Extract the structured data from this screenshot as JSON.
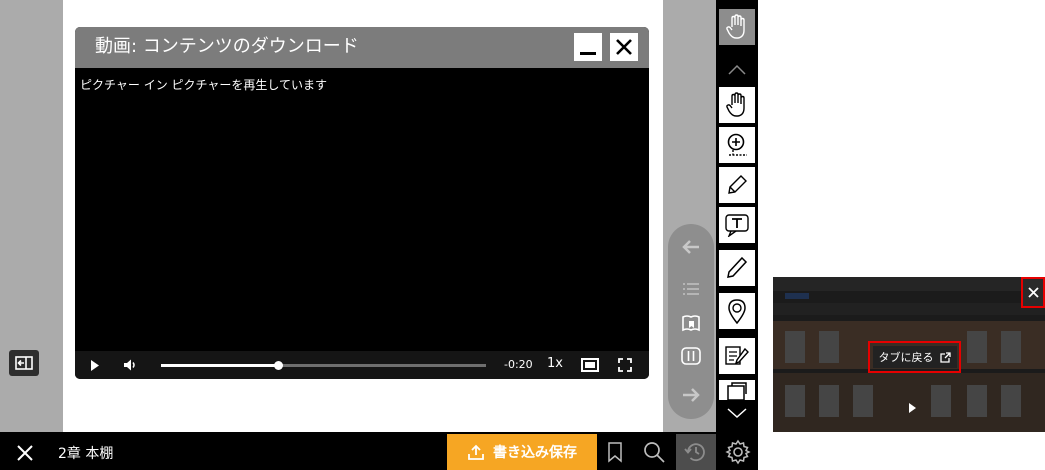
{
  "video_panel": {
    "title": "動画: コンテンツのダウンロード",
    "status_text": "ピクチャー イン ピクチャーを再生しています",
    "time_remaining": "-0:20",
    "speed": "1x",
    "progress": 0.36
  },
  "bottom_bar": {
    "chapter_label": "2章 本棚",
    "save_button_label": "書き込み保存"
  },
  "pip_window": {
    "return_to_tab_label": "タブに戻る"
  },
  "colors": {
    "accent_orange": "#f6a623",
    "highlight_red": "#e60000",
    "toolbar_dark": "#2b2b2b"
  }
}
